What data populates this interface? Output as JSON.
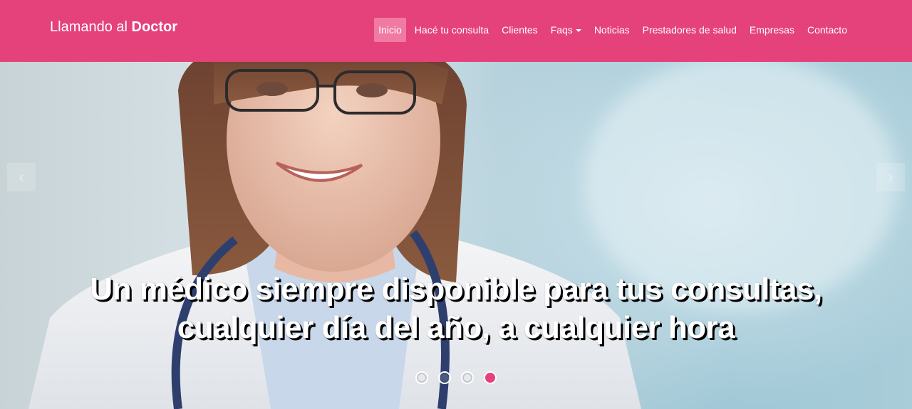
{
  "brand": {
    "prefix": "Llamando al ",
    "bold": "Doctor"
  },
  "nav": [
    {
      "label": "Inicio",
      "active": true
    },
    {
      "label": "Hacé tu consulta"
    },
    {
      "label": "Clientes"
    },
    {
      "label": "Faqs",
      "dropdown": true
    },
    {
      "label": "Noticias"
    },
    {
      "label": "Prestadores de salud"
    },
    {
      "label": "Empresas"
    },
    {
      "label": "Contacto"
    }
  ],
  "hero": {
    "caption_line1": "Un médico siempre disponible para tus consultas,",
    "caption_line2": "cualquier día del año, a cualquier hora",
    "prev_icon": "chevron-left-icon",
    "next_icon": "chevron-right-icon",
    "slide_count": 4,
    "active_slide": 4
  },
  "colors": {
    "brand": "#e5417a",
    "active_nav": "#f07aa2",
    "text": "#ffffff"
  }
}
